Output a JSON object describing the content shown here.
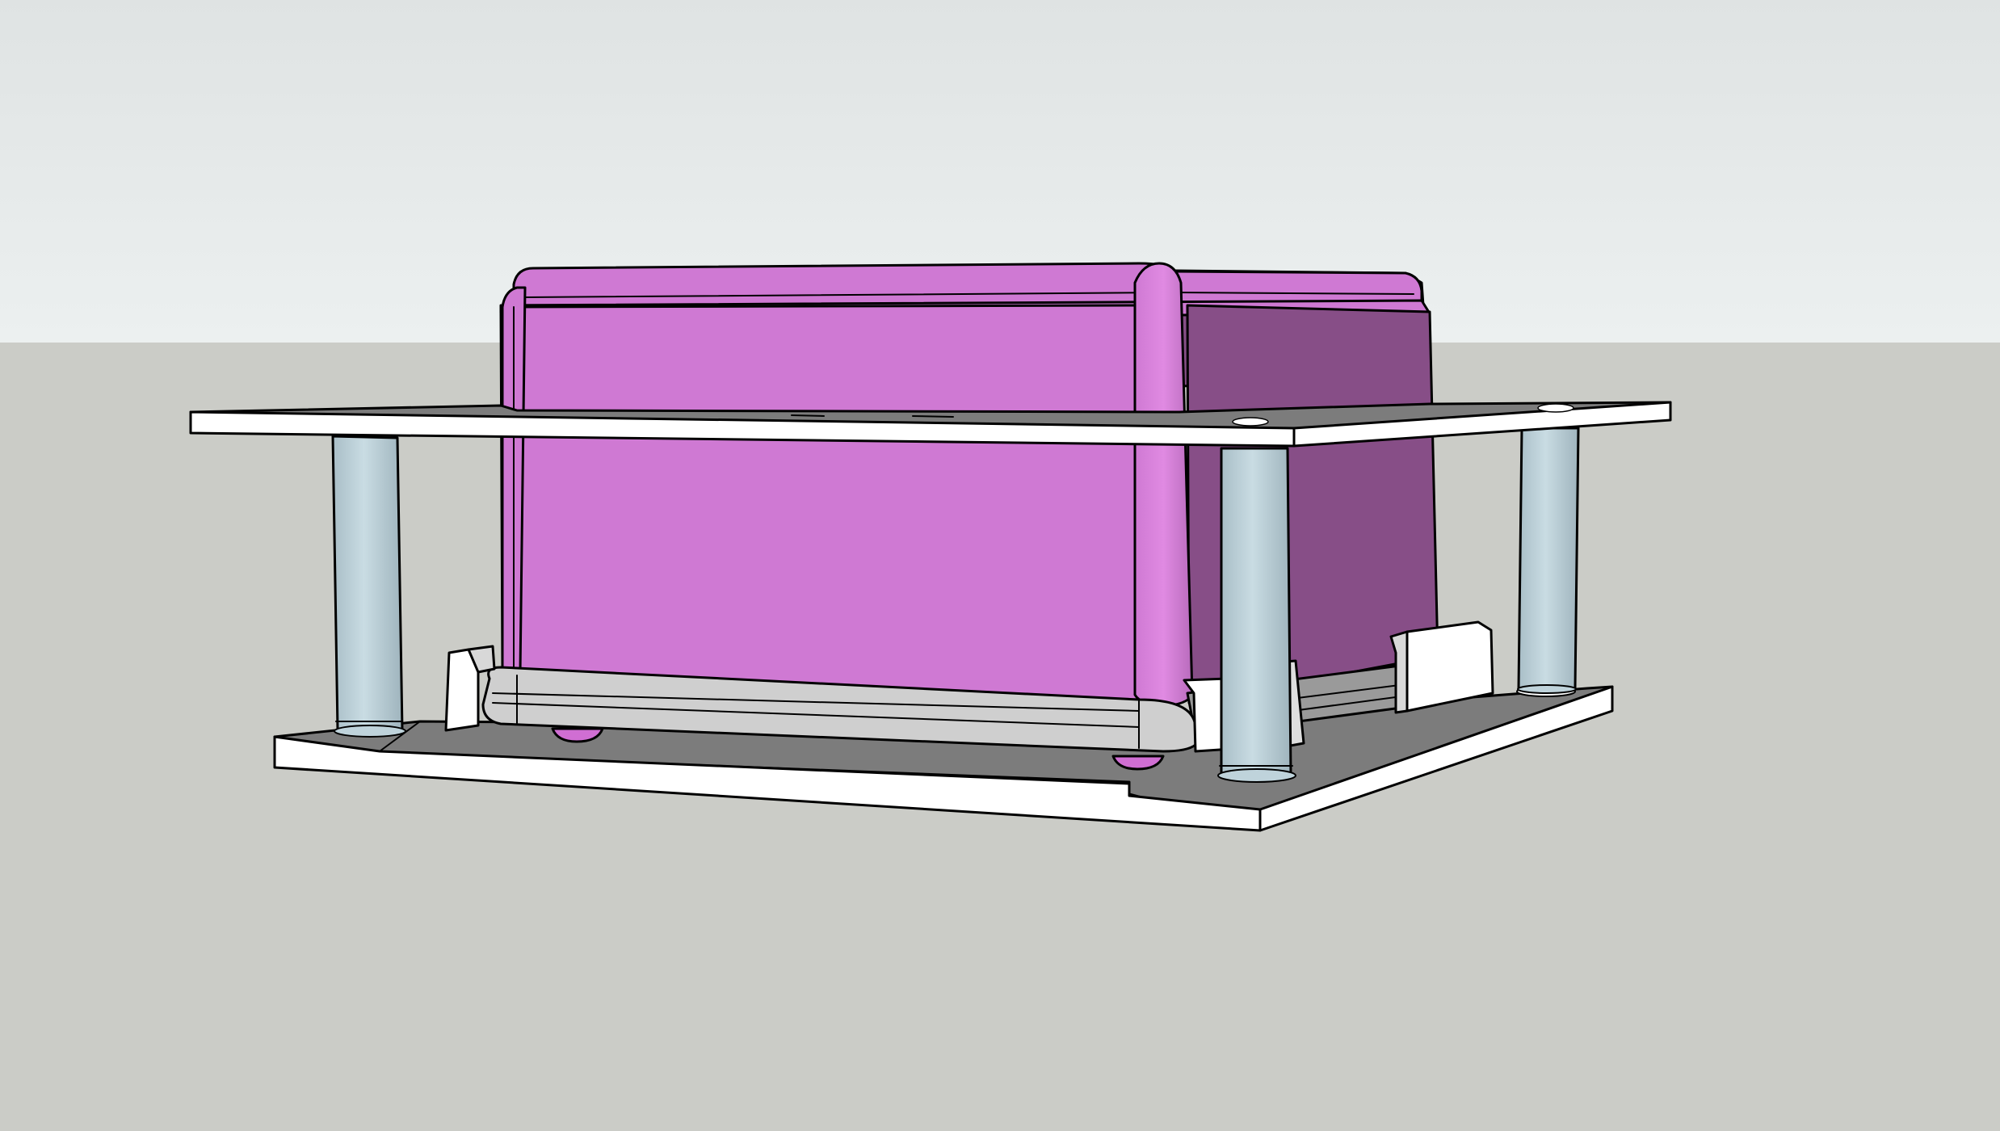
{
  "scene": {
    "sky_top_color": "#dfe3e3",
    "sky_bottom_color": "#ecf0f0",
    "ground_color": "#cbccc7",
    "enclosure_front_color": "#cf79d3",
    "enclosure_side_color": "#874e87",
    "enclosure_highlight_color": "#d97ddc",
    "plate_top_color": "#7c7c7c",
    "plate_edge_color": "#ffffff",
    "standoff_color": "#bfd3db",
    "bracket_color": "#ffffff",
    "rail_color": "#cfcfcf"
  },
  "objects": [
    "plastic-enclosure-box",
    "top-mounting-plate",
    "bottom-mounting-plate",
    "standoff-post",
    "retaining-bracket",
    "enclosure-mounting-rail"
  ]
}
